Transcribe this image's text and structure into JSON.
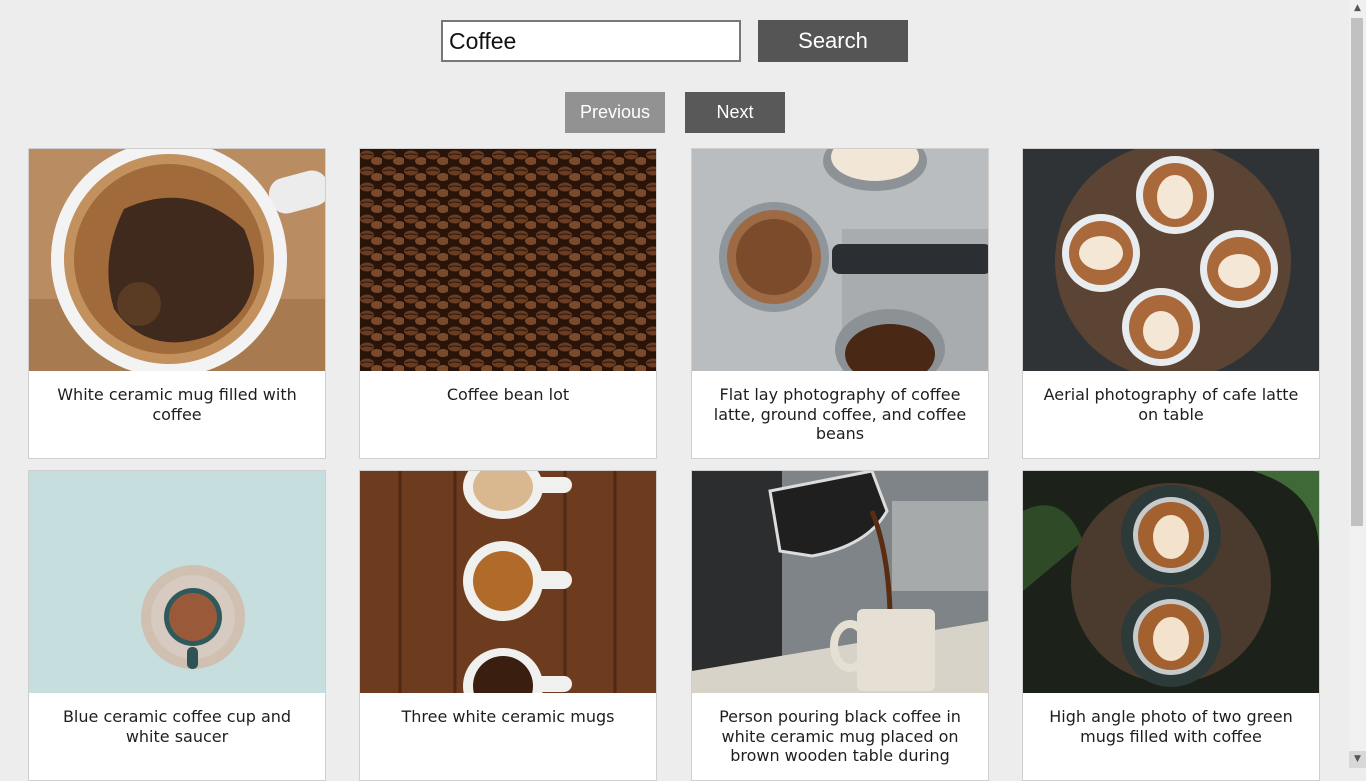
{
  "search": {
    "value": "Coffee",
    "button_label": "Search"
  },
  "pagination": {
    "previous_label": "Previous",
    "next_label": "Next"
  },
  "photos": [
    {
      "caption": "White ceramic mug filled with coffee"
    },
    {
      "caption": "Coffee bean lot"
    },
    {
      "caption": "Flat lay photography of coffee latte, ground coffee, and coffee beans"
    },
    {
      "caption": "Aerial photography of cafe latte on table"
    },
    {
      "caption": "Blue ceramic coffee cup and white saucer"
    },
    {
      "caption": "Three white ceramic mugs"
    },
    {
      "caption": "Person pouring black coffee in white ceramic mug placed on brown wooden table during"
    },
    {
      "caption": "High angle photo of two green mugs filled with coffee"
    }
  ],
  "scrollbar": {
    "up_icon": "▲",
    "down_icon": "▼"
  }
}
